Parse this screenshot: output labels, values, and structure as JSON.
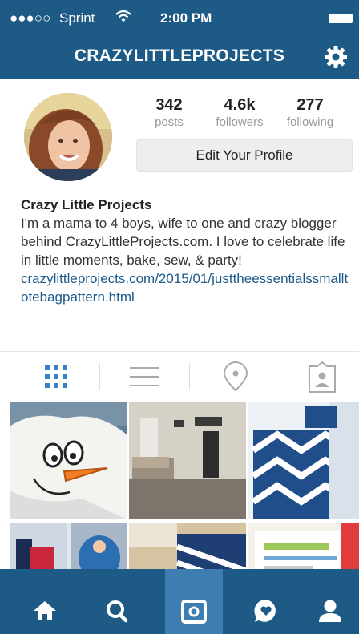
{
  "status_bar": {
    "signal": "●●●○○",
    "carrier": "Sprint",
    "wifi_icon": "wifi-icon",
    "time": "2:00 PM",
    "battery_icon": "battery-icon"
  },
  "nav": {
    "title": "CRAZYLITTLEPROJECTS",
    "settings_icon": "gear-icon"
  },
  "profile": {
    "stats": [
      {
        "value": "342",
        "label": "posts"
      },
      {
        "value": "4.6k",
        "label": "followers"
      },
      {
        "value": "277",
        "label": "following"
      }
    ],
    "edit_button": "Edit Your Profile",
    "name": "Crazy Little Projects",
    "bio": "I'm a mama to 4 boys, wife to one and crazy blogger behind CrazyLittleProjects.com. I love to celebrate life in little moments, bake, sew, & party!",
    "link": "crazylittleprojects.com/2015/01/justtheessentialssmalltotebagpattern.html"
  },
  "view_tabs": [
    {
      "name": "grid-view",
      "icon": "grid-icon",
      "active": true
    },
    {
      "name": "list-view",
      "icon": "list-icon",
      "active": false
    },
    {
      "name": "places-view",
      "icon": "location-pin-icon",
      "active": false
    },
    {
      "name": "tagged-view",
      "icon": "tagged-person-icon",
      "active": false
    }
  ],
  "bottom_nav": [
    {
      "name": "home",
      "icon": "home-icon"
    },
    {
      "name": "explore",
      "icon": "search-icon"
    },
    {
      "name": "camera",
      "icon": "camera-icon",
      "active": true
    },
    {
      "name": "activity",
      "icon": "heart-bubble-icon"
    },
    {
      "name": "profile",
      "icon": "person-icon"
    }
  ],
  "colors": {
    "bar": "#1e5a86",
    "link": "#1a5a8c",
    "active_tab": "#3d7db0",
    "grid_active": "#3b7fc4"
  }
}
